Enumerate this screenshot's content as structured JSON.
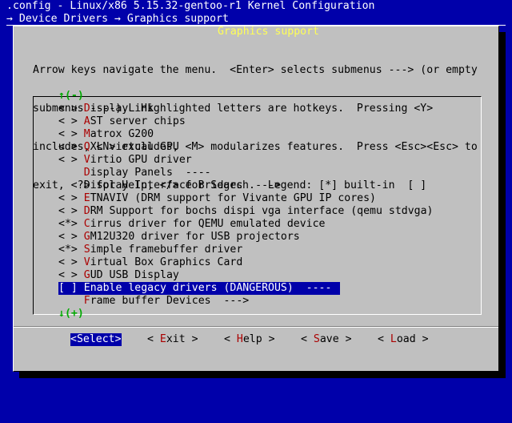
{
  "header": {
    "title_line": ".config - Linux/x86 5.15.32-gentoo-r1 Kernel Configuration",
    "breadcrumb_prefix": "→ ",
    "breadcrumb_item1": "Device Drivers",
    "breadcrumb_sep": " → ",
    "breadcrumb_item2": "Graphics support"
  },
  "dialog": {
    "title": " Graphics support ",
    "help_lines": [
      "Arrow keys navigate the menu.  <Enter> selects submenus ---> (or empty",
      "submenus ----).  Highlighted letters are hotkeys.  Pressing <Y>",
      "includes, <N> excludes, <M> modularizes features.  Press <Esc><Esc> to",
      "exit, <?> for Help, </> for Search.  Legend: [*] built-in  [ ]"
    ],
    "scroll_up": "↑(-)",
    "scroll_down": "↓(+)"
  },
  "menu": [
    {
      "prefix": "< > ",
      "hotkey": "D",
      "rest": "isplayLink"
    },
    {
      "prefix": "< > ",
      "hotkey": "A",
      "rest": "ST server chips"
    },
    {
      "prefix": "< > ",
      "hotkey": "M",
      "rest": "atrox G200"
    },
    {
      "prefix": "< > ",
      "hotkey": "Q",
      "rest": "XL virtual GPU"
    },
    {
      "prefix": "< > ",
      "hotkey": "V",
      "rest": "irtio GPU driver"
    },
    {
      "prefix": "    ",
      "hotkey": "D",
      "rest": "isplay Panels  ----"
    },
    {
      "prefix": "    ",
      "hotkey": "",
      "rest": "Display Interface Bridges  --->"
    },
    {
      "prefix": "< > ",
      "hotkey": "E",
      "rest": "TNAVIV (DRM support for Vivante GPU IP cores)"
    },
    {
      "prefix": "< > ",
      "hotkey": "D",
      "rest": "RM Support for bochs dispi vga interface (qemu stdvga)"
    },
    {
      "prefix": "<*> ",
      "hotkey": "C",
      "rest": "irrus driver for QEMU emulated device"
    },
    {
      "prefix": "< > ",
      "hotkey": "G",
      "rest": "M12U320 driver for USB projectors"
    },
    {
      "prefix": "<*> ",
      "hotkey": "S",
      "rest": "imple framebuffer driver"
    },
    {
      "prefix": "< > ",
      "hotkey": "V",
      "rest": "irtual Box Graphics Card"
    },
    {
      "prefix": "< > ",
      "hotkey": "G",
      "rest": "UD USB Display"
    },
    {
      "prefix": "[ ] ",
      "hotkey": "E",
      "rest": "nable legacy drivers (DANGEROUS)  ----",
      "selected": true
    },
    {
      "prefix": "    ",
      "hotkey": "F",
      "rest": "rame buffer Devices  --->"
    }
  ],
  "buttons": {
    "select": {
      "pre": "<",
      "hk": "S",
      "post": "elect>"
    },
    "exit": {
      "pre": "< ",
      "hk": "E",
      "post": "xit >"
    },
    "help": {
      "pre": "< ",
      "hk": "H",
      "post": "elp >"
    },
    "save": {
      "pre": "< ",
      "hk": "S",
      "post": "ave >"
    },
    "load": {
      "pre": "< ",
      "hk": "L",
      "post": "oad >"
    }
  },
  "colors": {
    "background": "#0000aa",
    "dialog": "#c0c0c0",
    "hotkey": "#aa0000",
    "title": "#ffff55",
    "scroll_arrow": "#00aa00"
  }
}
